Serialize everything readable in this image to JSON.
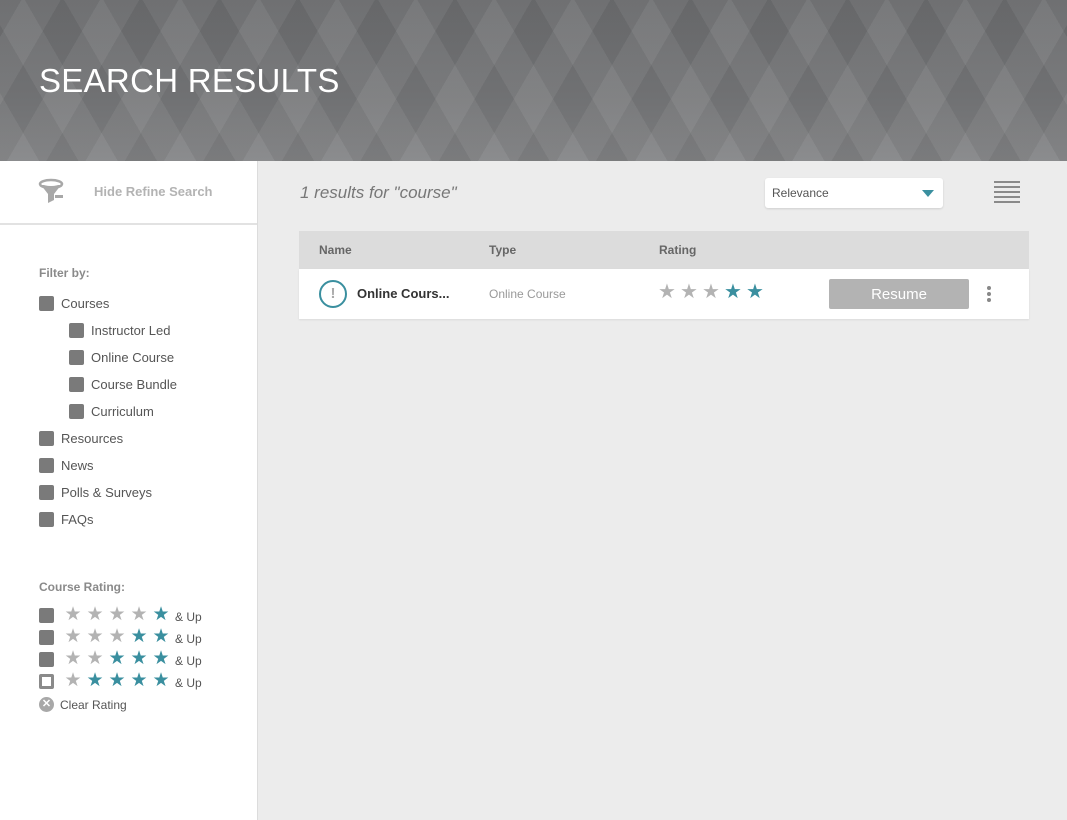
{
  "header": {
    "title": "SEARCH RESULTS"
  },
  "sidebar": {
    "toggle_label": "Hide Refine Search",
    "filter_title": "Filter by:",
    "filters": [
      {
        "label": "Courses",
        "checked": true,
        "level": 0
      },
      {
        "label": "Instructor Led",
        "checked": true,
        "level": 1
      },
      {
        "label": "Online Course",
        "checked": true,
        "level": 1
      },
      {
        "label": "Course Bundle",
        "checked": true,
        "level": 1
      },
      {
        "label": "Curriculum",
        "checked": true,
        "level": 1
      },
      {
        "label": "Resources",
        "checked": true,
        "level": 0
      },
      {
        "label": "News",
        "checked": true,
        "level": 0
      },
      {
        "label": "Polls & Surveys",
        "checked": true,
        "level": 0
      },
      {
        "label": "FAQs",
        "checked": true,
        "level": 0
      }
    ],
    "rating_title": "Course Rating:",
    "rating_filters": [
      {
        "stars": 1,
        "suffix": "& Up",
        "checked": true
      },
      {
        "stars": 2,
        "suffix": "& Up",
        "checked": true
      },
      {
        "stars": 3,
        "suffix": "& Up",
        "checked": true
      },
      {
        "stars": 4,
        "suffix": "& Up",
        "checked": false
      }
    ],
    "clear_rating_label": "Clear Rating"
  },
  "main": {
    "results_summary": "1 results for \"course\"",
    "sort": {
      "selected": "Relevance"
    },
    "table": {
      "headers": {
        "name": "Name",
        "type": "Type",
        "rating": "Rating"
      },
      "rows": [
        {
          "name": "Online Cours...",
          "type": "Online Course",
          "rating": 2,
          "action_label": "Resume",
          "status_icon": "!"
        }
      ]
    }
  },
  "icons": {
    "refine": "funnel-icon",
    "sort_caret": "caret-down-icon",
    "view": "list-view-icon",
    "star": "★",
    "clear": "✕",
    "more": "more-vertical-icon"
  },
  "colors": {
    "accent": "#3a8f9f",
    "star_off": "#b3b3b3",
    "button": "#b3b3b3"
  }
}
